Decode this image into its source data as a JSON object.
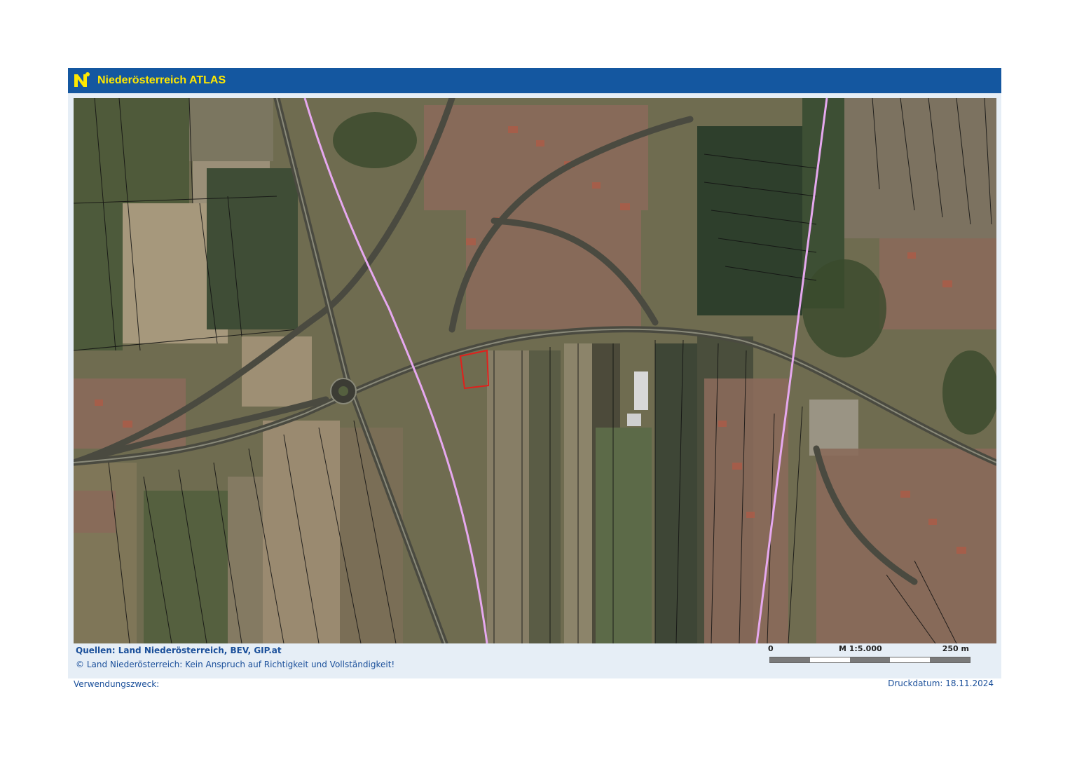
{
  "header": {
    "logo_icon": "noe-logo-icon",
    "title": "Niederösterreich ATLAS"
  },
  "map": {
    "scale": "M 1:5.000",
    "scale_start": "0",
    "scale_end": "250 m",
    "selected_parcel_color": "#e0201c",
    "boundary_color": "#e6a8ef"
  },
  "footer": {
    "sources": "Quellen: Land Niederösterreich, BEV, GIP.at",
    "copyright": "© Land Niederösterreich: Kein Anspruch auf Richtigkeit und Vollständigkeit!",
    "usage_label": "Verwendungszweck:",
    "print_date": "Druckdatum: 18.11.2024"
  },
  "colors": {
    "header_bg": "#1457a0",
    "title_color": "#ffe800",
    "footer_text": "#1a4f9a"
  }
}
